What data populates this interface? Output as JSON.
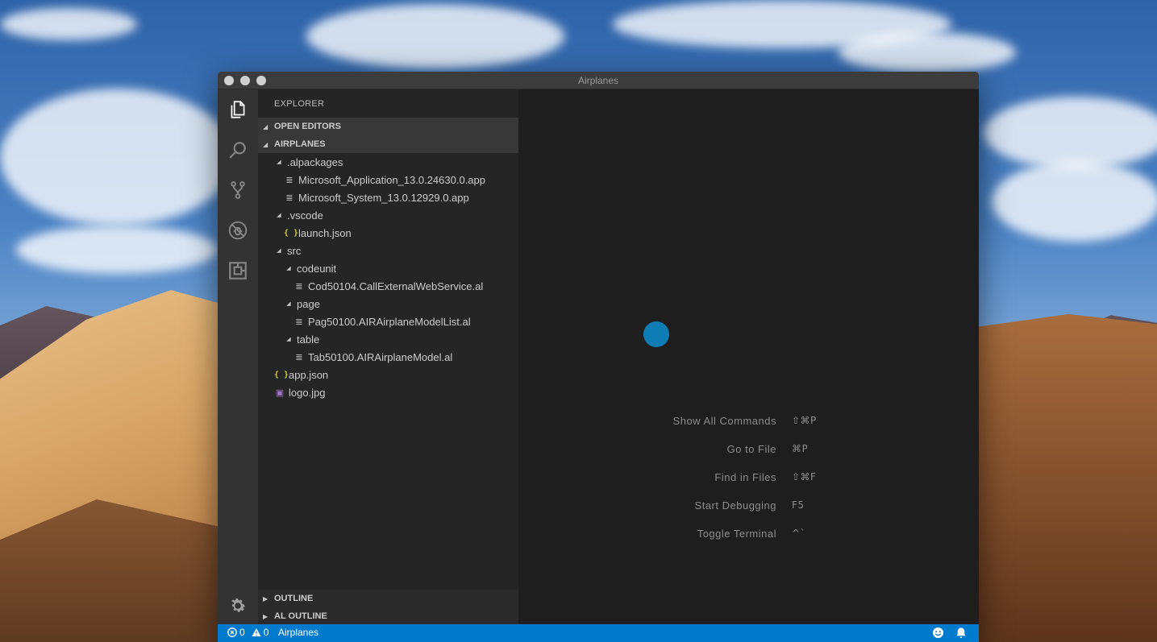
{
  "window": {
    "title": "Airplanes"
  },
  "activity_bar": {
    "items": [
      {
        "icon": "files-icon"
      },
      {
        "icon": "search-icon"
      },
      {
        "icon": "source-control-icon"
      },
      {
        "icon": "debug-icon"
      },
      {
        "icon": "extensions-icon"
      }
    ],
    "manage_icon": "gear-icon"
  },
  "sidebar": {
    "title": "EXPLORER",
    "sections": {
      "open_editors": "OPEN EDITORS",
      "workspace": "AIRPLANES",
      "outline": "OUTLINE",
      "al_outline": "AL OUTLINE"
    },
    "tree": [
      {
        "label": ".alpackages",
        "kind": "folder",
        "depth": 1
      },
      {
        "label": "Microsoft_Application_13.0.24630.0.app",
        "kind": "file-lines",
        "depth": 2
      },
      {
        "label": "Microsoft_System_13.0.12929.0.app",
        "kind": "file-lines",
        "depth": 2
      },
      {
        "label": ".vscode",
        "kind": "folder",
        "depth": 1
      },
      {
        "label": "launch.json",
        "kind": "file-json",
        "depth": 2
      },
      {
        "label": "src",
        "kind": "folder",
        "depth": 1
      },
      {
        "label": "codeunit",
        "kind": "folder",
        "depth": 2
      },
      {
        "label": "Cod50104.CallExternalWebService.al",
        "kind": "file-lines",
        "depth": 3
      },
      {
        "label": "page",
        "kind": "folder",
        "depth": 2
      },
      {
        "label": "Pag50100.AIRAirplaneModelList.al",
        "kind": "file-lines",
        "depth": 3
      },
      {
        "label": "table",
        "kind": "folder",
        "depth": 2
      },
      {
        "label": "Tab50100.AIRAirplaneModel.al",
        "kind": "file-lines",
        "depth": 3
      },
      {
        "label": "app.json",
        "kind": "file-json",
        "depth": 1
      },
      {
        "label": "logo.jpg",
        "kind": "file-image",
        "depth": 1
      }
    ]
  },
  "editor": {
    "shortcuts": [
      {
        "label": "Show All Commands",
        "keys": "⇧⌘P"
      },
      {
        "label": "Go to File",
        "keys": "⌘P"
      },
      {
        "label": "Find in Files",
        "keys": "⇧⌘F"
      },
      {
        "label": "Start Debugging",
        "keys": "F5"
      },
      {
        "label": "Toggle Terminal",
        "keys": "^`"
      }
    ]
  },
  "statusbar": {
    "errors": "0",
    "warnings": "0",
    "project": "Airplanes"
  },
  "colors": {
    "accent": "#007acc",
    "activity_bar": "#333333",
    "sidebar": "#252526",
    "editor": "#1e1e1e"
  }
}
